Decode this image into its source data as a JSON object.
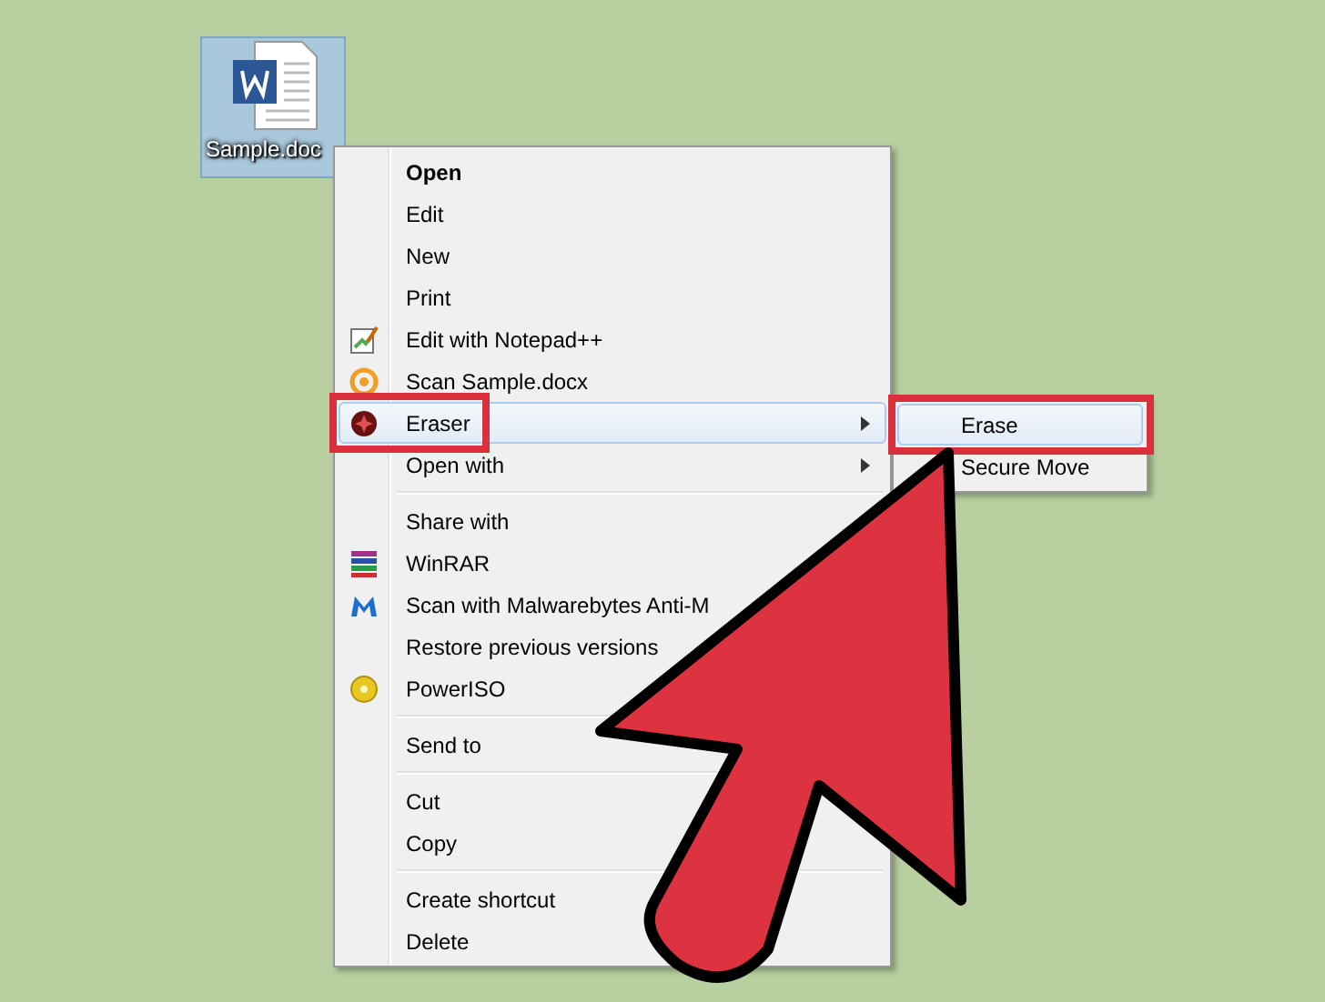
{
  "desktop_icon": {
    "label": "Sample.doc",
    "selected": true
  },
  "context_menu": {
    "items": [
      {
        "kind": "plain",
        "label": "Open",
        "default": true,
        "selected": false,
        "submenu": false,
        "callout": false
      },
      {
        "kind": "plain",
        "label": "Edit",
        "default": false,
        "selected": false,
        "submenu": false,
        "callout": false
      },
      {
        "kind": "plain",
        "label": "New",
        "default": false,
        "selected": false,
        "submenu": false,
        "callout": false
      },
      {
        "kind": "plain",
        "label": "Print",
        "default": false,
        "selected": false,
        "submenu": false,
        "callout": false
      },
      {
        "kind": "notepad",
        "label": "Edit with Notepad++",
        "default": false,
        "selected": false,
        "submenu": false,
        "callout": false
      },
      {
        "kind": "scan",
        "label": "Scan Sample.docx",
        "default": false,
        "selected": false,
        "submenu": false,
        "callout": false
      },
      {
        "kind": "eraser",
        "label": "Eraser",
        "default": false,
        "selected": true,
        "submenu": true,
        "callout": true
      },
      {
        "kind": "plain",
        "label": "Open with",
        "default": false,
        "selected": false,
        "submenu": true,
        "callout": false
      },
      {
        "kind": "separator"
      },
      {
        "kind": "plain",
        "label": "Share with",
        "default": false,
        "selected": false,
        "submenu": false,
        "callout": false
      },
      {
        "kind": "books",
        "label": "WinRAR",
        "default": false,
        "selected": false,
        "submenu": false,
        "callout": false
      },
      {
        "kind": "malware",
        "label": "Scan with Malwarebytes Anti-M",
        "default": false,
        "selected": false,
        "submenu": false,
        "callout": false
      },
      {
        "kind": "plain",
        "label": "Restore previous versions",
        "default": false,
        "selected": false,
        "submenu": false,
        "callout": false
      },
      {
        "kind": "disc",
        "label": "PowerISO",
        "default": false,
        "selected": false,
        "submenu": false,
        "callout": false
      },
      {
        "kind": "separator"
      },
      {
        "kind": "plain",
        "label": "Send to",
        "default": false,
        "selected": false,
        "submenu": false,
        "callout": false
      },
      {
        "kind": "separator"
      },
      {
        "kind": "plain",
        "label": "Cut",
        "default": false,
        "selected": false,
        "submenu": false,
        "callout": false
      },
      {
        "kind": "plain",
        "label": "Copy",
        "default": false,
        "selected": false,
        "submenu": false,
        "callout": false
      },
      {
        "kind": "separator"
      },
      {
        "kind": "plain",
        "label": "Create shortcut",
        "default": false,
        "selected": false,
        "submenu": false,
        "callout": false
      },
      {
        "kind": "plain",
        "label": "Delete",
        "default": false,
        "selected": false,
        "submenu": false,
        "callout": false
      }
    ]
  },
  "submenu": {
    "items": [
      {
        "label": "Erase",
        "selected": true,
        "callout": true
      },
      {
        "label": "Secure Move",
        "selected": false,
        "callout": false
      }
    ]
  }
}
